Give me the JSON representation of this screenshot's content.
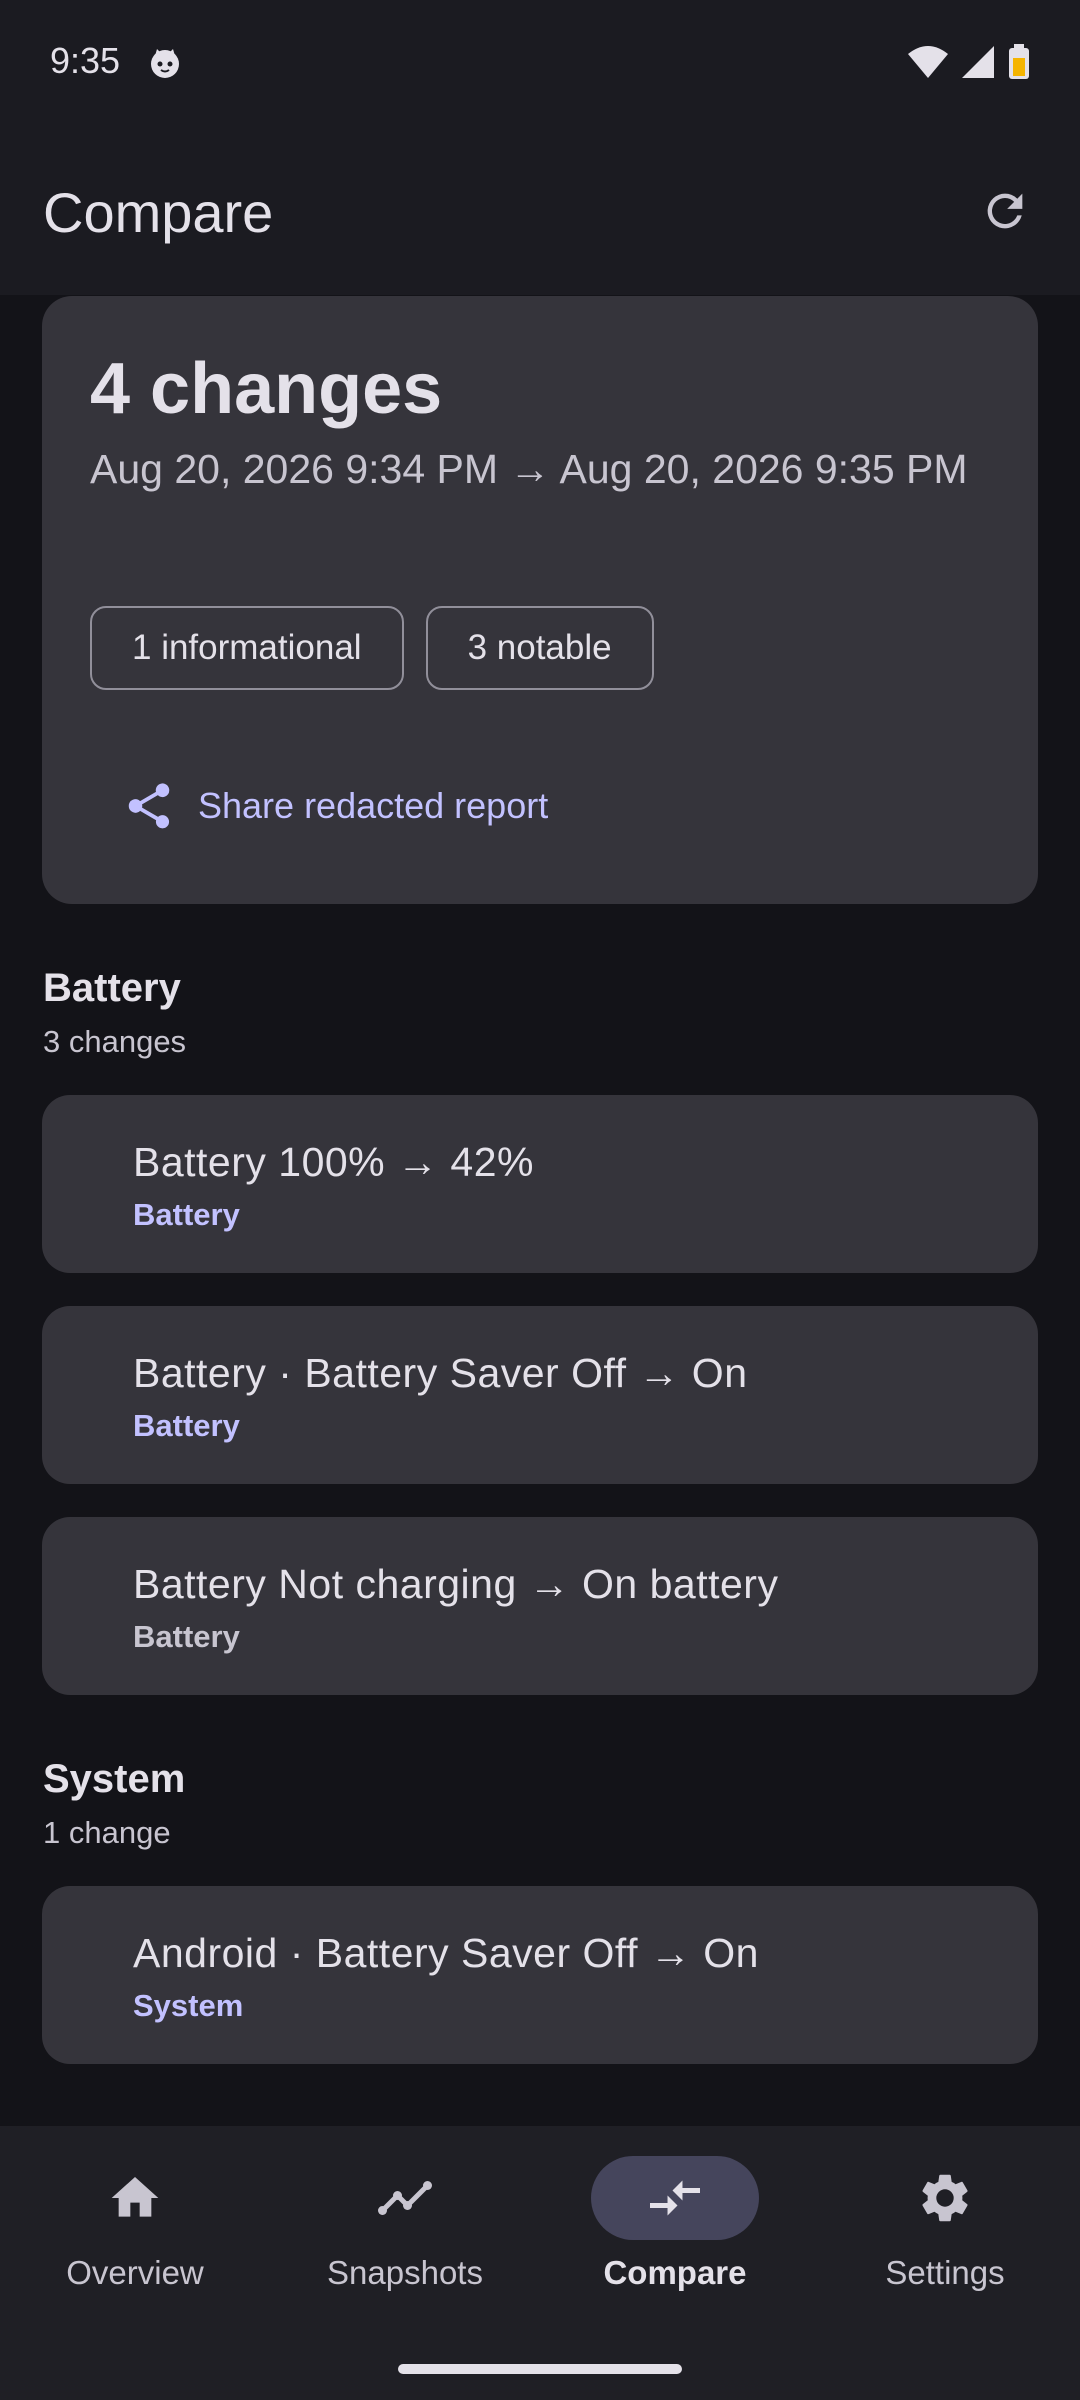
{
  "status_bar": {
    "time": "9:35"
  },
  "app_bar": {
    "title": "Compare",
    "refresh_icon": "refresh-icon"
  },
  "summary": {
    "count_text": "4 changes",
    "range_text": "Aug 20, 2026 9:34 PM → Aug 20, 2026 9:35 PM",
    "chips": [
      "1 informational",
      "3 notable"
    ],
    "share_label": "Share redacted report"
  },
  "sections": [
    {
      "title": "Battery",
      "subtitle": "3 changes",
      "items": [
        {
          "title": "Battery 100% → 42%",
          "category": "Battery"
        },
        {
          "title": "Battery · Battery Saver Off → On",
          "category": "Battery"
        },
        {
          "title": "Battery Not charging → On battery",
          "category": "Battery"
        }
      ]
    },
    {
      "title": "System",
      "subtitle": "1 change",
      "items": [
        {
          "title": "Android · Battery Saver Off → On",
          "category": "System"
        }
      ]
    }
  ],
  "nav": {
    "items": [
      {
        "label": "Overview",
        "icon": "home-icon"
      },
      {
        "label": "Snapshots",
        "icon": "trend-icon"
      },
      {
        "label": "Compare",
        "icon": "compare-icon"
      },
      {
        "label": "Settings",
        "icon": "gear-icon"
      }
    ],
    "active_index": 2
  },
  "colors": {
    "accent": "#c2c1ff",
    "surface": "#35343b",
    "background": "#131318"
  }
}
